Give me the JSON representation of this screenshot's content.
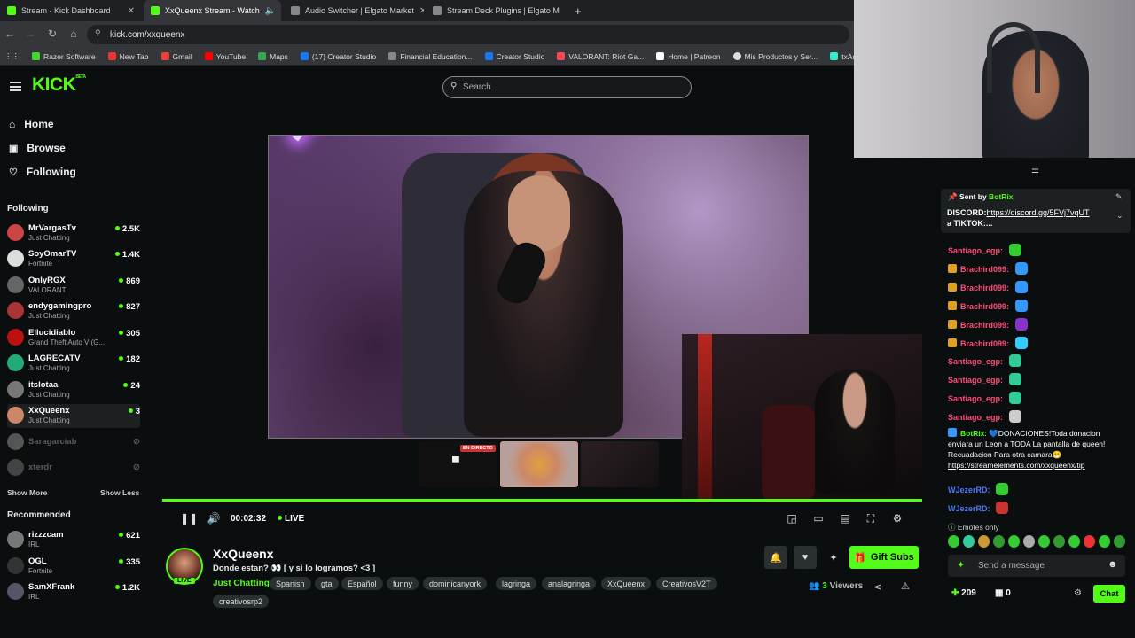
{
  "browser": {
    "tabs": [
      {
        "label": "Stream - Kick Dashboard"
      },
      {
        "label": "XxQueenx Stream - Watch"
      },
      {
        "label": "Audio Switcher | Elgato Market"
      },
      {
        "label": "Stream Deck Plugins | Elgato M"
      }
    ],
    "new_tab": "+",
    "url": "kick.com/xxqueenx",
    "bookmarks": [
      {
        "label": "Razer Software",
        "color": "#44d62c"
      },
      {
        "label": "New Tab",
        "color": "#e33"
      },
      {
        "label": "Gmail",
        "color": "#ea4335"
      },
      {
        "label": "YouTube",
        "color": "#ff0000"
      },
      {
        "label": "Maps",
        "color": "#34a853"
      },
      {
        "label": "(17) Creator Studio",
        "color": "#1877f2"
      },
      {
        "label": "Financial Education...",
        "color": "#888"
      },
      {
        "label": "Creator Studio",
        "color": "#1877f2"
      },
      {
        "label": "VALORANT: Riot Ga...",
        "color": "#ff4655"
      },
      {
        "label": "Home | Patreon",
        "color": "#fff"
      },
      {
        "label": "Mis Productos y Ser...",
        "color": "#ddd"
      },
      {
        "label": "txAdmin - FiveM/Re",
        "color": "#3ec"
      }
    ]
  },
  "kick": {
    "logo": "KICK",
    "logo_sup": "BETA",
    "search_placeholder": "Search",
    "nav": [
      {
        "label": "Home",
        "icon": "home-icon"
      },
      {
        "label": "Browse",
        "icon": "browse-icon"
      },
      {
        "label": "Following",
        "icon": "heart-icon"
      }
    ],
    "following_header": "Following",
    "following": [
      {
        "name": "MrVargasTv",
        "category": "Just Chatting",
        "viewers": "2.5K",
        "color": "#c44"
      },
      {
        "name": "SoyOmarTV",
        "category": "Fortnite",
        "viewers": "1.4K",
        "color": "#ddd"
      },
      {
        "name": "OnlyRGX",
        "category": "VALORANT",
        "viewers": "869",
        "color": "#666"
      },
      {
        "name": "endygamingpro",
        "category": "Just Chatting",
        "viewers": "827",
        "color": "#a33"
      },
      {
        "name": "Ellucidiablo",
        "category": "Grand Theft Auto V (G...",
        "viewers": "305",
        "color": "#b11"
      },
      {
        "name": "LAGRECATV",
        "category": "Just Chatting",
        "viewers": "182",
        "color": "#2a7"
      },
      {
        "name": "itslotaa",
        "category": "Just Chatting",
        "viewers": "24",
        "color": "#777"
      },
      {
        "name": "XxQueenx",
        "category": "Just Chatting",
        "viewers": "3",
        "color": "#c86"
      }
    ],
    "offline": [
      {
        "name": "Saragarciab",
        "color": "#555"
      },
      {
        "name": "xterdr",
        "color": "#444"
      }
    ],
    "show_more": "Show More",
    "show_less": "Show Less",
    "recommended_header": "Recommended",
    "recommended": [
      {
        "name": "rizzzcam",
        "category": "IRL",
        "viewers": "621",
        "color": "#777"
      },
      {
        "name": "OGL",
        "category": "Fortnite",
        "viewers": "335",
        "color": "#333"
      },
      {
        "name": "SamXFrank",
        "category": "IRL",
        "viewers": "1.2K",
        "color": "#556"
      }
    ]
  },
  "player": {
    "live_badge": "EN DIRECTO",
    "time": "00:02:32",
    "live": "LIVE",
    "progress": 1.0
  },
  "stream": {
    "name": "XxQueenx",
    "title": "Donde estan? 👀 [ y si lo logramos? <3 ]",
    "live_tag": "LIVE",
    "category": "Just Chatting",
    "tags": [
      "Spanish",
      "gta",
      "Español",
      "funny",
      "dominicanyork",
      "lagringa",
      "analagringa",
      "XxQueenx",
      "CreativosV2T"
    ],
    "tags2": [
      "creativosrp2"
    ],
    "gift_subs": "Gift Subs",
    "viewers_count": "3",
    "viewers_label": "Viewers"
  },
  "chat": {
    "pinned_by": "Sent by",
    "pinned_user": "BotRix",
    "pinned_text_prefix": "DISCORD:",
    "pinned_link": "https://discord.gg/5FVj7vqUT",
    "pinned_text_suffix": "a TIKTOK:...",
    "messages": [
      {
        "user": "Santiago_egp",
        "color": "#ff4d7a",
        "badge": false,
        "emote": "#3c3"
      },
      {
        "user": "Brachird099",
        "color": "#ff4d7a",
        "badge": true,
        "emote": "#39f"
      },
      {
        "user": "Brachird099",
        "color": "#ff4d7a",
        "badge": true,
        "emote": "#39f"
      },
      {
        "user": "Brachird099",
        "color": "#ff4d7a",
        "badge": true,
        "emote": "#39f"
      },
      {
        "user": "Brachird099",
        "color": "#ff4d7a",
        "badge": true,
        "emote": "#83c"
      },
      {
        "user": "Brachird099",
        "color": "#ff4d7a",
        "badge": true,
        "emote": "#3cf"
      },
      {
        "user": "Santiago_egp",
        "color": "#ff4d7a",
        "badge": false,
        "emote": "#3c9"
      },
      {
        "user": "Santiago_egp",
        "color": "#ff4d7a",
        "badge": false,
        "emote": "#3c9"
      },
      {
        "user": "Santiago_egp",
        "color": "#ff4d7a",
        "badge": false,
        "emote": "#3c9"
      },
      {
        "user": "Santiago_egp",
        "color": "#ff4d7a",
        "badge": false,
        "emote": "#ccc"
      }
    ],
    "bot_user": "BotRix",
    "bot_text": "💙DONACIONES!Toda donacion enviara un Leon a TODA La pantalla de queen! Recuadacion Para otra camara😁",
    "bot_link": "https://streamelements.com/xxqueenx/tip",
    "later": [
      {
        "user": "WJezerRD",
        "color": "#4d7aff",
        "emote": "#3c3"
      },
      {
        "user": "WJezerRD",
        "color": "#4d7aff",
        "emote": "#c33"
      }
    ],
    "emotes_only": "Emotes only",
    "emote_colors": [
      "#3c3",
      "#3c9",
      "#c93",
      "#393",
      "#3c3",
      "#aaa",
      "#3c3",
      "#393",
      "#3c3",
      "#e33",
      "#3c3",
      "#393",
      "#3c3",
      "#3c3"
    ],
    "input_placeholder": "Send a message",
    "points": "209",
    "points2": "0",
    "chat_button": "Chat"
  }
}
